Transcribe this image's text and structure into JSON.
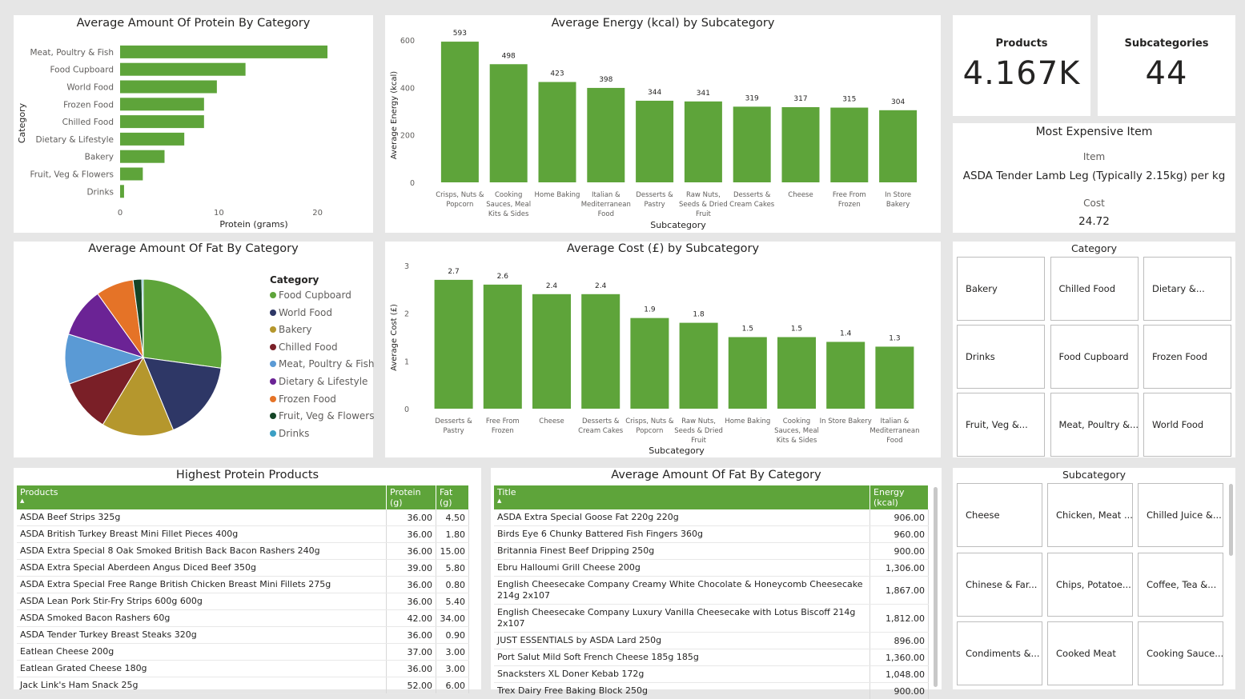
{
  "protein_chart": {
    "title": "Average Amount Of Protein By Category",
    "xlabel": "Protein (grams)",
    "ylabel": "Category",
    "x_ticks": [
      "0",
      "10",
      "20"
    ],
    "chart_data": {
      "type": "bar",
      "orientation": "horizontal",
      "categories": [
        "Meat, Poultry & Fish",
        "Food Cupboard",
        "World Food",
        "Frozen Food",
        "Chilled Food",
        "Dietary & Lifestyle",
        "Bakery",
        "Fruit, Veg & Flowers",
        "Drinks"
      ],
      "values": [
        21.0,
        12.7,
        9.8,
        8.5,
        8.5,
        6.5,
        4.5,
        2.3,
        0.4
      ],
      "xlim": [
        0,
        24
      ],
      "color": "#5ea43a"
    }
  },
  "energy_chart": {
    "title": "Average Energy (kcal) by Subcategory",
    "xlabel": "Subcategory",
    "ylabel": "Average Energy (kcal)",
    "y_ticks": [
      "0",
      "200",
      "400",
      "600"
    ],
    "chart_data": {
      "type": "bar",
      "categories": [
        [
          "Crisps, Nuts &",
          "Popcorn"
        ],
        [
          "Cooking",
          "Sauces, Meal",
          "Kits & Sides"
        ],
        [
          "Home Baking"
        ],
        [
          "Italian &",
          "Mediterranean",
          "Food"
        ],
        [
          "Desserts &",
          "Pastry"
        ],
        [
          "Raw Nuts,",
          "Seeds & Dried",
          "Fruit"
        ],
        [
          "Desserts &",
          "Cream Cakes"
        ],
        [
          "Cheese"
        ],
        [
          "Free From",
          "Frozen"
        ],
        [
          "In Store",
          "Bakery"
        ]
      ],
      "values": [
        593,
        498,
        423,
        398,
        344,
        341,
        319,
        317,
        315,
        304
      ],
      "labels": [
        "593",
        "498",
        "423",
        "398",
        "344",
        "341",
        "319",
        "317",
        "315",
        "304"
      ],
      "ylim": [
        0,
        600
      ],
      "color": "#5ea43a"
    }
  },
  "fat_pie": {
    "title": "Average Amount Of Fat By Category",
    "legend_title": "Category",
    "chart_data": {
      "type": "pie",
      "labels": [
        "Food Cupboard",
        "World Food",
        "Bakery",
        "Chilled Food",
        "Meat, Poultry & Fish",
        "Dietary & Lifestyle",
        "Frozen Food",
        "Fruit, Veg & Flowers",
        "Drinks"
      ],
      "values": [
        27.2,
        16.6,
        14.9,
        10.9,
        10.3,
        10.3,
        7.8,
        1.8,
        0.3
      ],
      "colors": [
        "#5ea43a",
        "#2e3766",
        "#b5972d",
        "#7a1f27",
        "#5a9ad5",
        "#6b2395",
        "#e57327",
        "#144526",
        "#3b9fc4"
      ]
    }
  },
  "cost_chart": {
    "title": "Average Cost (£) by Subcategory",
    "xlabel": "Subcategory",
    "ylabel": "Average Cost (£)",
    "y_ticks": [
      "0",
      "1",
      "2",
      "3"
    ],
    "chart_data": {
      "type": "bar",
      "categories": [
        [
          "Desserts &",
          "Pastry"
        ],
        [
          "Free From",
          "Frozen"
        ],
        [
          "Cheese"
        ],
        [
          "Desserts &",
          "Cream Cakes"
        ],
        [
          "Crisps, Nuts &",
          "Popcorn"
        ],
        [
          "Raw Nuts,",
          "Seeds & Dried",
          "Fruit"
        ],
        [
          "Home Baking"
        ],
        [
          "Cooking",
          "Sauces, Meal",
          "Kits & Sides"
        ],
        [
          "In Store Bakery"
        ],
        [
          "Italian &",
          "Mediterranean",
          "Food"
        ]
      ],
      "values": [
        2.7,
        2.6,
        2.4,
        2.4,
        1.9,
        1.8,
        1.5,
        1.5,
        1.4,
        1.3
      ],
      "labels": [
        "2.7",
        "2.6",
        "2.4",
        "2.4",
        "1.9",
        "1.8",
        "1.5",
        "1.5",
        "1.4",
        "1.3"
      ],
      "ylim": [
        0,
        3
      ],
      "color": "#5ea43a"
    }
  },
  "kpis": {
    "products_label": "Products",
    "products_value": "4.167K",
    "subcategories_label": "Subcategories",
    "subcategories_value": "44"
  },
  "most_expensive": {
    "title": "Most Expensive Item",
    "item_label": "Item",
    "item_value": "ASDA Tender Lamb Leg (Typically 2.15kg) per kg",
    "cost_label": "Cost",
    "cost_value": "24.72"
  },
  "category_slicer": {
    "title": "Category",
    "tiles": [
      "Bakery",
      "Chilled Food",
      "Dietary &...",
      "Drinks",
      "Food Cupboard",
      "Frozen Food",
      "Fruit, Veg &...",
      "Meat, Poultry &...",
      "World Food"
    ]
  },
  "subcategory_slicer": {
    "title": "Subcategory",
    "tiles": [
      "Cheese",
      "Chicken, Meat ...",
      "Chilled Juice &...",
      "Chinese & Far...",
      "Chips, Potatoe...",
      "Coffee, Tea &...",
      "Condiments &...",
      "Cooked Meat",
      "Cooking Sauce..."
    ]
  },
  "protein_table": {
    "title": "Highest Protein Products",
    "columns": [
      "Products",
      "Protein (g)",
      "Fat (g)"
    ],
    "rows": [
      [
        "ASDA Beef Strips 325g",
        "36.00",
        "4.50"
      ],
      [
        "ASDA British Turkey Breast Mini Fillet Pieces 400g",
        "36.00",
        "1.80"
      ],
      [
        "ASDA Extra Special 8 Oak Smoked British Back Bacon Rashers 240g",
        "36.00",
        "15.00"
      ],
      [
        "ASDA Extra Special Aberdeen Angus Diced Beef 350g",
        "39.00",
        "5.80"
      ],
      [
        "ASDA Extra Special Free Range British Chicken Breast Mini Fillets 275g",
        "36.00",
        "0.80"
      ],
      [
        "ASDA Lean Pork Stir-Fry Strips 600g 600g",
        "36.00",
        "5.40"
      ],
      [
        "ASDA Smoked Bacon Rashers 60g",
        "42.00",
        "34.00"
      ],
      [
        "ASDA Tender Turkey Breast Steaks 320g",
        "36.00",
        "0.90"
      ],
      [
        "Eatlean Cheese 200g",
        "37.00",
        "3.00"
      ],
      [
        "Eatlean Grated Cheese 180g",
        "36.00",
        "3.00"
      ],
      [
        "Jack Link's Ham Snack 25g",
        "52.00",
        "6.00"
      ]
    ]
  },
  "fat_table": {
    "title": "Average Amount Of Fat By Category",
    "columns": [
      "Title",
      "Energy (kcal)"
    ],
    "rows": [
      [
        "ASDA Extra Special Goose Fat 220g 220g",
        "906.00"
      ],
      [
        "Birds Eye 6 Chunky Battered Fish Fingers 360g",
        "960.00"
      ],
      [
        "Britannia Finest Beef Dripping 250g",
        "900.00"
      ],
      [
        "Ebru Halloumi Grill Cheese 200g",
        "1,306.00"
      ],
      [
        "English Cheesecake Company Creamy White Chocolate & Honeycomb Cheesecake 214g 2x107",
        "1,867.00"
      ],
      [
        "English Cheesecake Company Luxury Vanilla Cheesecake with Lotus Biscoff 214g 2x107",
        "1,812.00"
      ],
      [
        "JUST ESSENTIALS by ASDA Lard 250g",
        "896.00"
      ],
      [
        "Port Salut Mild Soft French Cheese 185g 185g",
        "1,360.00"
      ],
      [
        "Snacksters XL Doner Kebab 172g",
        "1,048.00"
      ],
      [
        "Trex Dairy Free Baking Block 250g",
        "900.00"
      ]
    ]
  }
}
